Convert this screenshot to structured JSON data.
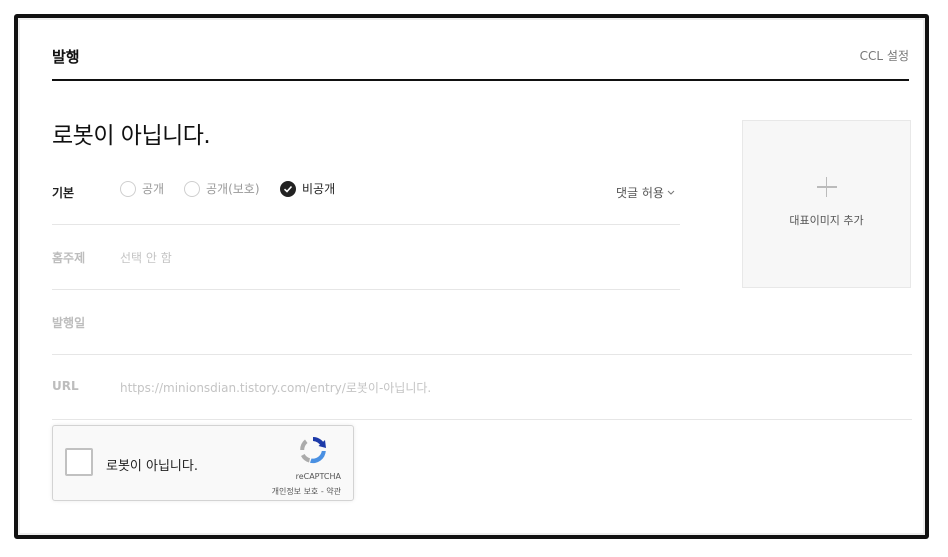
{
  "header": {
    "title": "발행",
    "ccl_link": "CCL 설정"
  },
  "main": {
    "title": "로봇이 아닙니다.",
    "basic_label": "기본",
    "visibility_options": [
      {
        "label": "공개",
        "checked": false
      },
      {
        "label": "공개(보호)",
        "checked": false
      },
      {
        "label": "비공개",
        "checked": true
      }
    ],
    "comment_setting": "댓글 허용",
    "home_topic": {
      "label": "홈주제",
      "value": "선택 안 함"
    },
    "publish_date": {
      "label": "발행일"
    },
    "url": {
      "label": "URL",
      "value": "https://minionsdian.tistory.com/entry/로봇이-아닙니다."
    }
  },
  "thumbnail": {
    "label": "대표이미지 추가"
  },
  "captcha": {
    "label": "로봇이 아닙니다.",
    "brand": "reCAPTCHA",
    "links": "개인정보 보호 - 약관"
  },
  "colors": {
    "accent": "#222222",
    "muted_text": "#c4c4c4",
    "divider": "#e6e6e6",
    "recaptcha_blue": "#1c3aa9",
    "recaptcha_light_blue": "#4a90e2"
  }
}
